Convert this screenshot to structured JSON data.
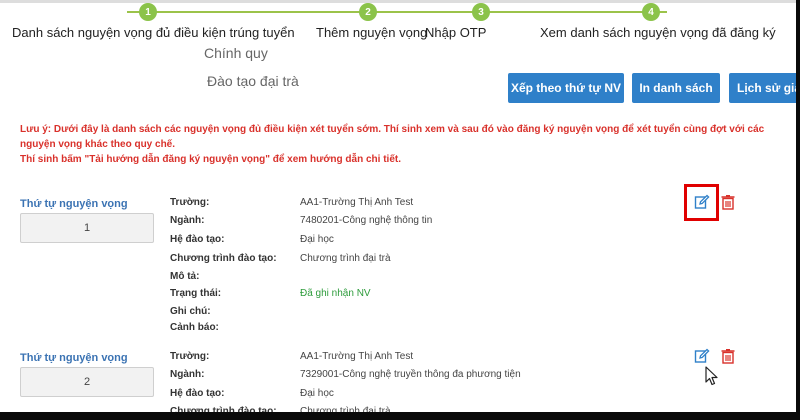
{
  "stepper": {
    "steps": [
      {
        "num": "1",
        "label": "Danh sách nguyện vọng đủ điều kiện trúng tuyển"
      },
      {
        "num": "2",
        "label": "Thêm nguyện vọng"
      },
      {
        "num": "3",
        "label": "Nhập OTP"
      },
      {
        "num": "4",
        "label": "Xem danh sách nguyện vọng đã đăng ký"
      }
    ],
    "accent_color": "#8bc34a"
  },
  "header": {
    "subtitle_1": "Chính quy",
    "subtitle_2": "Đào tạo đại trà"
  },
  "toolbar": {
    "sort_button": "Xếp theo thứ tự NV",
    "print_button": "In danh sách",
    "history_button": "Lịch sử giao",
    "button_color": "#2f80c9"
  },
  "notice": {
    "line_1": "Lưu ý: Dưới đây là danh sách các nguyện vọng đủ điều kiện xét tuyển sớm. Thí sinh xem và sau đó vào đăng ký nguyện vọng để xét tuyển cùng đợt với các",
    "line_2": "nguyện vọng khác theo quy chế.",
    "line_3": "Thí sinh bấm \"Tải hướng dẫn đăng ký nguyện vọng\" để xem hướng dẫn chi tiết.",
    "color": "#d9312b"
  },
  "labels": {
    "order": "Thứ tự nguyện vọng",
    "school": "Trường:",
    "major": "Ngành:",
    "system": "Hệ đào tạo:",
    "program": "Chương trình đào tạo:",
    "description": "Mô tả:",
    "status": "Trạng thái:",
    "note": "Ghi chú:",
    "warning": "Cảnh báo:"
  },
  "wishes": [
    {
      "order": "1",
      "school": "AA1-Trường Thị Anh Test",
      "major": "7480201-Công nghệ thông tin",
      "system": "Đại học",
      "program": "Chương trình đại trà",
      "description": "",
      "status": "Đã ghi nhận NV",
      "note": "",
      "warning": ""
    },
    {
      "order": "2",
      "school": "AA1-Trường Thị Anh Test",
      "major": "7329001-Công nghệ truyền thông đa phương tiện",
      "system": "Đại học",
      "program": "Chương trình đại trà"
    }
  ],
  "icons": {
    "edit": "edit-icon",
    "delete": "trash-icon",
    "edit_color": "#2f80c9",
    "delete_color": "#d9312b"
  }
}
